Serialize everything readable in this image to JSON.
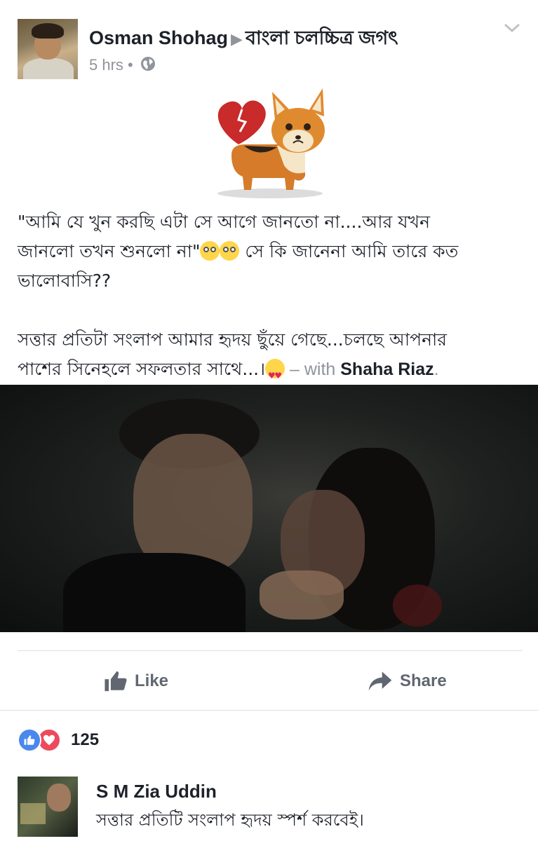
{
  "post": {
    "author": "Osman Shohag",
    "group": "বাংলা চলচ্চিত্র জগৎ",
    "time": "5 hrs",
    "dot": "•",
    "line1": "\"আমি যে খুন করছি এটা সে আগে জানতো না....আর যখন",
    "line2a": "জানলো তখন শুনলো না\"",
    "line2b": " সে কি জানেনা আমি তারে কত",
    "line3": "ভালোবাসি??",
    "line4": "সত্তার প্রতিটা সংলাপ আমার হৃদয় ছুঁয়ে গেছে...চলছে আপনার",
    "line5": "পাশের সিনেহলে সফলতার সাথে...।",
    "with_text": " – with ",
    "tagged_user": "Shaha Riaz",
    "period": "."
  },
  "actions": {
    "like_label": "Like",
    "share_label": "Share"
  },
  "reactions": {
    "count": "125"
  },
  "comment": {
    "author": "S M Zia Uddin",
    "text": "সত্তার প্রতিটি সংলাপ হৃদয় স্পর্শ করবেই।"
  },
  "colors": {
    "text": "#1d2129",
    "secondary": "#90949c",
    "like_blue": "#4a88ee",
    "love_red": "#ee4a5e"
  },
  "icons": {
    "globe": "globe-icon",
    "chevron": "chevron-down-icon",
    "like": "thumbs-up-icon",
    "share": "share-arrow-icon"
  }
}
